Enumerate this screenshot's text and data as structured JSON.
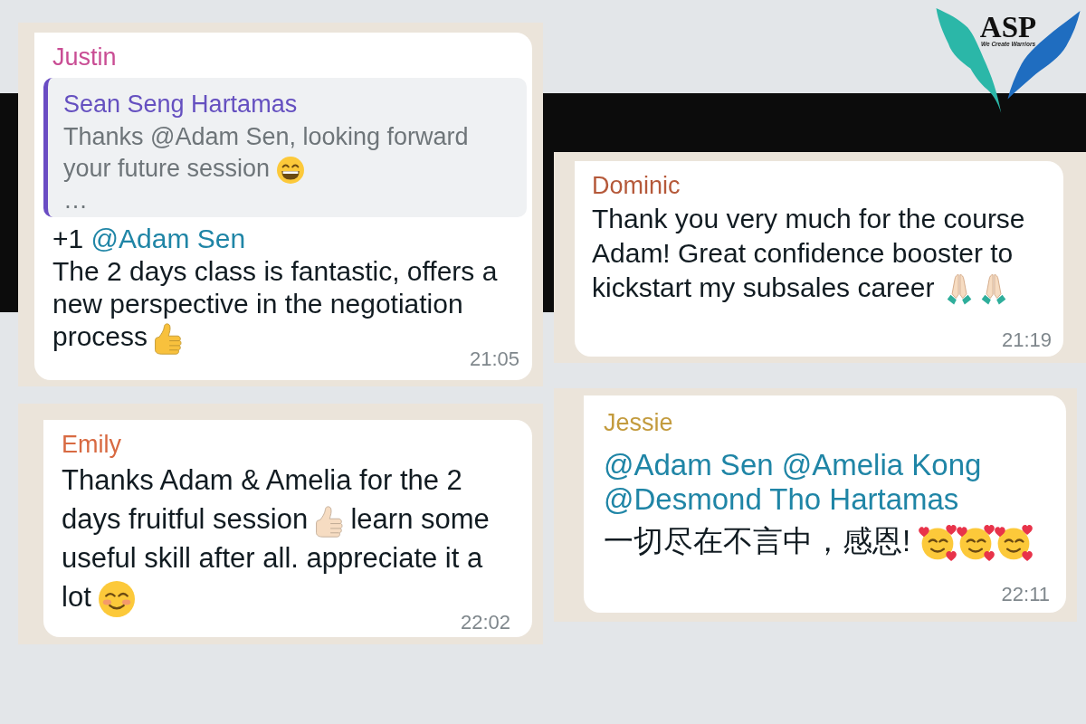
{
  "logo": {
    "title": "ASP",
    "tagline": "We Create Warriors"
  },
  "messages": [
    {
      "sender": "Justin",
      "color": "#c94d94",
      "quote": {
        "sender": "Sean Seng Hartamas",
        "paragraphs": [
          [
            {
              "kind": "text",
              "text": "Thanks @Adam Sen, looking forward your future session"
            },
            {
              "kind": "grin"
            }
          ],
          [
            {
              "kind": "text",
              "text": "…"
            }
          ]
        ]
      },
      "paragraphs": [
        [
          {
            "kind": "text",
            "text": "+1"
          },
          {
            "kind": "mention",
            "text": "@Adam Sen"
          }
        ],
        [
          {
            "kind": "text",
            "text": "The 2 days class is fantastic, offers a new perspective in the negotiation process"
          },
          {
            "kind": "thumb",
            "color": "#f8c13d"
          }
        ]
      ],
      "time": "21:05"
    },
    {
      "sender": "Dominic",
      "color": "#b5593a",
      "paragraphs": [
        [
          {
            "kind": "text",
            "text": "Thank you very much for the course Adam! Great confidence booster to kickstart my subsales career"
          },
          {
            "kind": "pray"
          },
          {
            "kind": "pray"
          }
        ]
      ],
      "time": "21:19"
    },
    {
      "sender": "Emily",
      "color": "#d86a42",
      "paragraphs": [
        [
          {
            "kind": "text",
            "text": "Thanks Adam & Amelia for the 2 days fruitful session"
          },
          {
            "kind": "thumb",
            "color": "#f6dcc2"
          },
          {
            "kind": "text",
            "text": "learn some useful skill after all. appreciate it a lot"
          },
          {
            "kind": "blush"
          }
        ]
      ],
      "time": "22:02"
    },
    {
      "sender": "Jessie",
      "color": "#c39b3e",
      "paragraphs": [
        [
          {
            "kind": "mention",
            "text": "@Adam Sen"
          },
          {
            "kind": "mention",
            "text": "@Amelia Kong"
          },
          {
            "kind": "mention",
            "text": "@Desmond Tho Hartamas"
          }
        ],
        [
          {
            "kind": "text",
            "text": "一切尽在不言中，感恩!"
          },
          {
            "kind": "adore"
          },
          {
            "kind": "adore"
          },
          {
            "kind": "adore"
          }
        ]
      ],
      "time": "22:11"
    }
  ]
}
